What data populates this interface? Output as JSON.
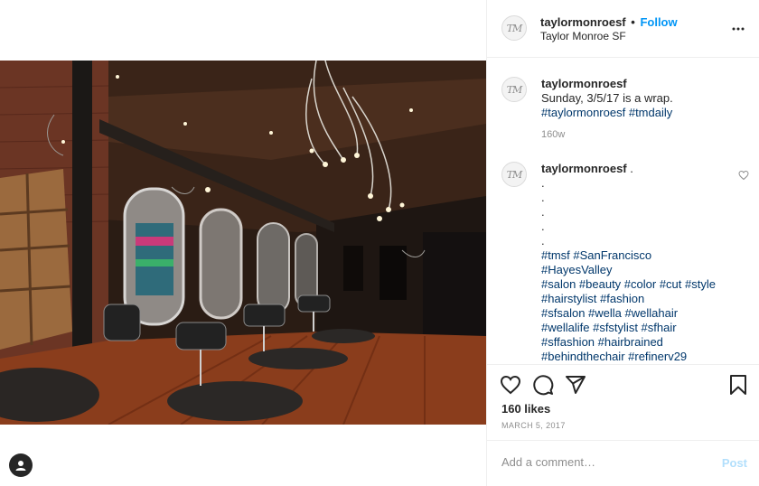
{
  "header": {
    "username": "taylormonroesf",
    "separator": "•",
    "follow_label": "Follow",
    "location": "Taylor Monroe SF",
    "more_icon": "more-icon",
    "avatar_initials": "TM"
  },
  "caption": {
    "username": "taylormonroesf",
    "text": "Sunday, 3/5/17 is a wrap.",
    "tags": [
      "#taylormonroesf",
      "#tmdaily"
    ],
    "time": "160w"
  },
  "comment": {
    "username": "taylormonroesf",
    "trail": " .",
    "dots": [
      ".",
      ".",
      ".",
      ".",
      "."
    ],
    "tag_lines": [
      "#tmsf #SanFrancisco",
      "#HayesValley",
      "#salon #beauty #color #cut #style",
      "#hairstylist #fashion",
      "#sfsalon #wella #wellahair",
      "#wellalife #sfstylist #sfhair",
      "#sffashion #hairbrained",
      "#behindthechair #refinerv29"
    ]
  },
  "actions": {
    "like_icon": "heart-icon",
    "comment_icon": "comment-icon",
    "share_icon": "share-icon",
    "save_icon": "bookmark-icon",
    "likes": "160 likes",
    "date": "MARCH 5, 2017"
  },
  "add_comment": {
    "placeholder": "Add a comment…",
    "post_label": "Post"
  },
  "colors": {
    "link_blue": "#0095f6",
    "hashtag": "#00376b",
    "muted": "#8e8e8e",
    "post_disabled": "#b2dffc"
  }
}
